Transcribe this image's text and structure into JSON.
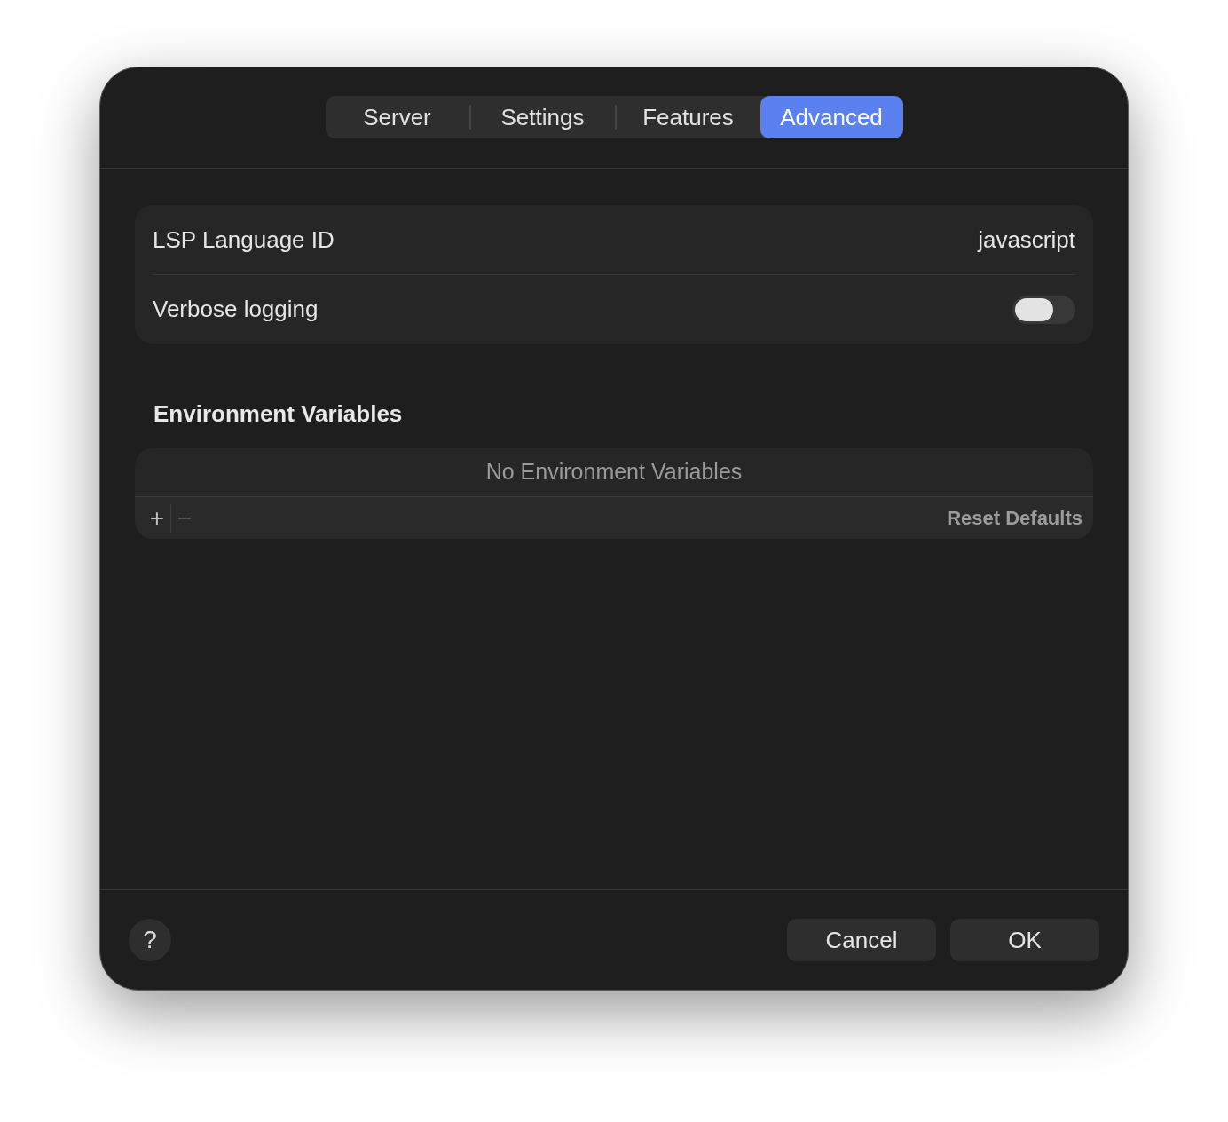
{
  "tabs": [
    {
      "label": "Server",
      "selected": false
    },
    {
      "label": "Settings",
      "selected": false
    },
    {
      "label": "Features",
      "selected": false
    },
    {
      "label": "Advanced",
      "selected": true
    }
  ],
  "settings": [
    {
      "kind": "value",
      "label": "LSP Language ID",
      "value": "javascript"
    },
    {
      "kind": "toggle",
      "label": "Verbose logging",
      "on": false
    }
  ],
  "environment_variables": {
    "title": "Environment Variables",
    "empty_text": "No Environment Variables",
    "buttons": [
      {
        "label": "+",
        "disabled": false
      },
      {
        "label": "−",
        "disabled": true
      }
    ],
    "reset_button": "Reset Defaults"
  },
  "footer": {
    "help_button": "?",
    "buttons": [
      "Cancel",
      "OK"
    ]
  }
}
